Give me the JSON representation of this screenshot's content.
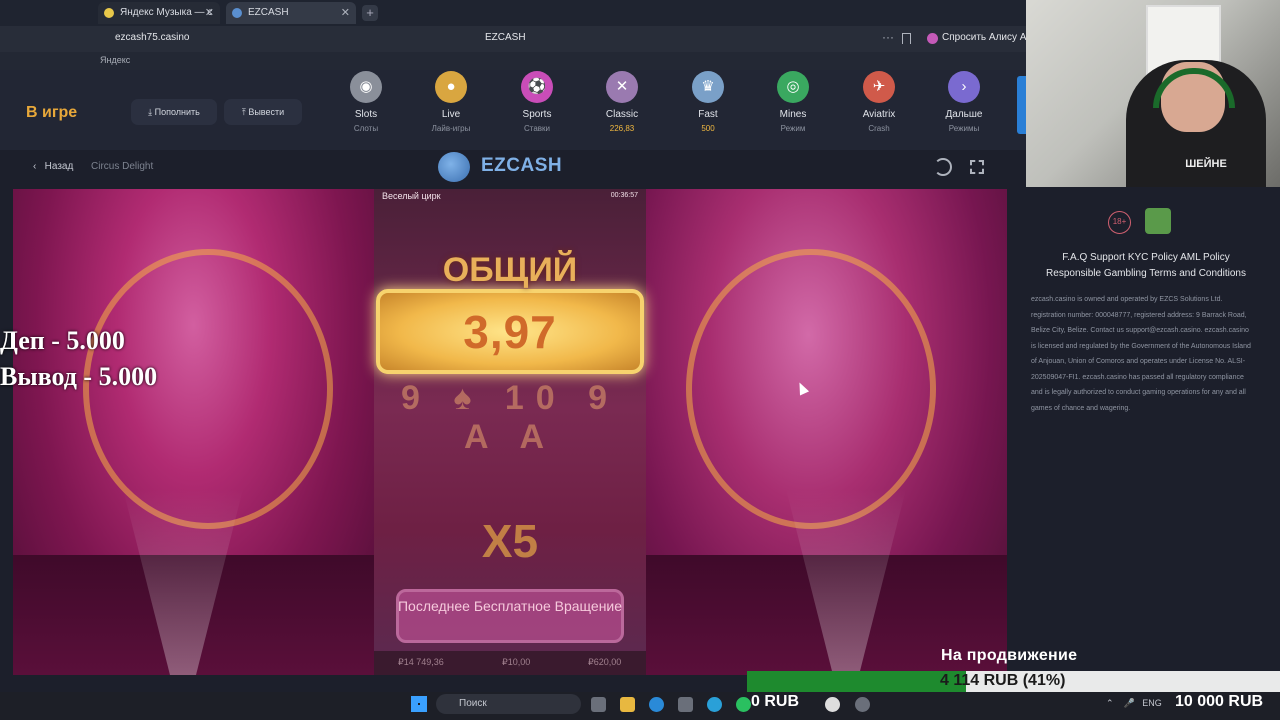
{
  "browser": {
    "tabs": [
      {
        "label": "Яндекс Музыка — с"
      },
      {
        "label": "EZCASH"
      }
    ],
    "url": "ezcash75.casino",
    "page_title": "EZCASH",
    "alisa": "Спросить Алису А",
    "bookmark_bar": "Яндекс"
  },
  "header": {
    "status": "В игре",
    "deposit": "Пополнить",
    "withdraw": "Вывести",
    "categories": [
      {
        "label": "Slots",
        "sub": "Слоты",
        "color": "#8a8f9a",
        "icon": "slots-icon"
      },
      {
        "label": "Live",
        "sub": "Лайв-игры",
        "color": "#d9a640",
        "icon": "live-icon"
      },
      {
        "label": "Sports",
        "sub": "Ставки",
        "color": "#c94db8",
        "icon": "sports-icon"
      },
      {
        "label": "Classic",
        "sub": "226,83",
        "color": "#9a7ab0",
        "icon": "classic-icon"
      },
      {
        "label": "Fast",
        "sub": "500",
        "color": "#7aa0c8",
        "icon": "fast-icon"
      },
      {
        "label": "Mines",
        "sub": "Режим",
        "color": "#3aa860",
        "icon": "mines-icon"
      },
      {
        "label": "Aviatrix",
        "sub": "Crash",
        "color": "#d05a4a",
        "icon": "aviatrix-icon"
      },
      {
        "label": "Дальше",
        "sub": "Режимы",
        "color": "#7a6ad0",
        "icon": "next-icon"
      }
    ]
  },
  "gamebar": {
    "back": "Назад",
    "game_name": "Circus Delight",
    "logo": "EZCASH"
  },
  "game": {
    "title": "Веселый цирк",
    "time": "00:36:57",
    "total_label": "ОБЩИЙ",
    "total_value": "3,97",
    "reels": "9 ♠ 10 9 A A",
    "multiplier": "X5",
    "last_spin": "Последнее Бесплатное Вращение",
    "balance": "₽14 749,36",
    "bet": "₽10,00",
    "win": "₽620,00"
  },
  "overlay": {
    "line1": "Деп - 5.000",
    "line2": "Вывод - 5.000"
  },
  "footer": {
    "age": "18+",
    "links1": "F.A.Q  Support  KYC Policy  AML Policy",
    "links2": "Responsible Gambling  Terms and Conditions",
    "legal": "ezcash.casino is owned and operated by EZCS Solutions Ltd. registration number: 000048777, registered address: 9 Barrack Road, Belize City, Belize. Contact us support@ezcash.casino. ezcash.casino is licensed and regulated by the Government of the Autonomous Island of Anjouan, Union of Comoros and operates under License No. ALSI-202509047-FI1. ezcash.casino has passed all regulatory compliance and is legally authorized to conduct gaming operations for any and all games of chance and wagering."
  },
  "stream": {
    "webcam_shirt": "ШЕЙНЕ",
    "promo_label": "На продвижение",
    "promo_progress": "4 114 RUB (41%)",
    "promo_fraction": 0.41,
    "taskbar_rub": "0 RUB",
    "taskbar_total": "10 000 RUB"
  },
  "taskbar": {
    "search": "Поиск",
    "lang": "ENG"
  }
}
